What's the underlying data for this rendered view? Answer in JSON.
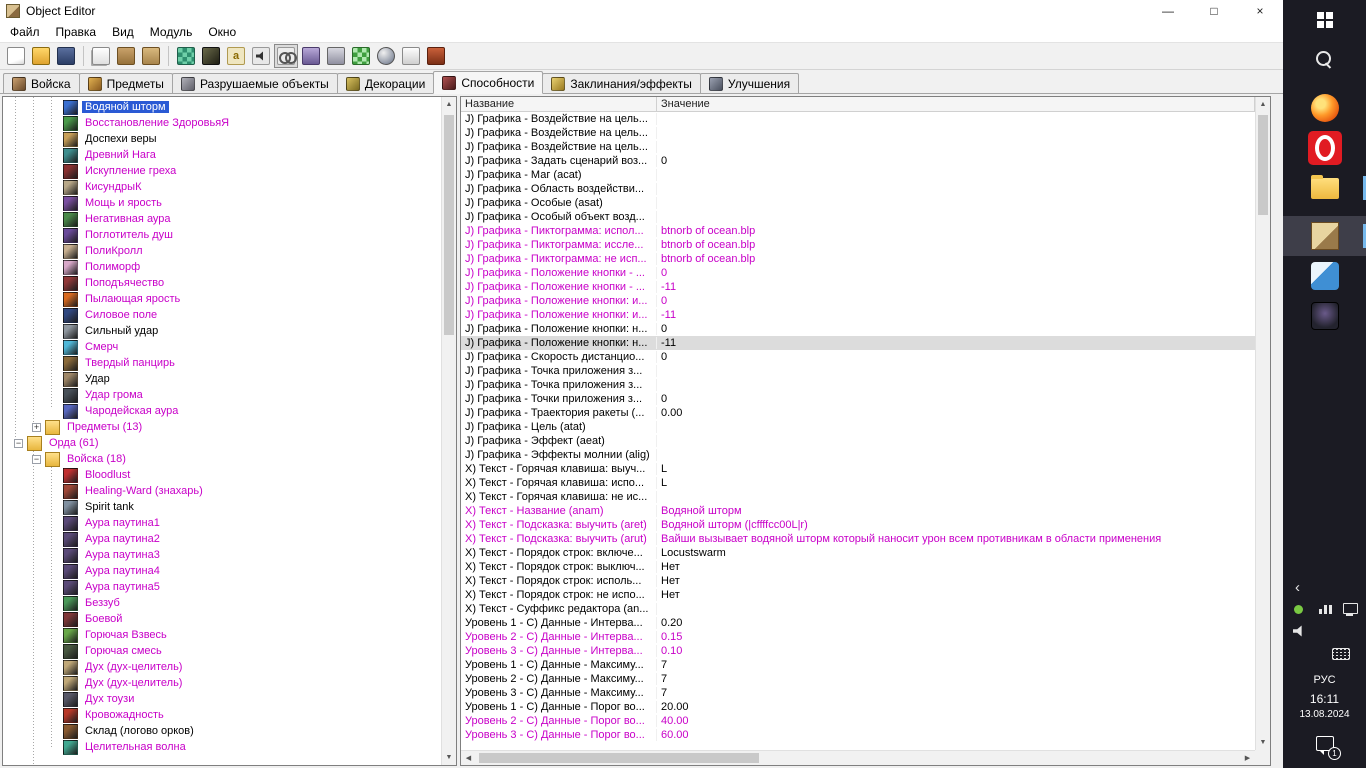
{
  "window": {
    "title": "Object Editor",
    "min": "—",
    "max": "□",
    "close": "×"
  },
  "colors": {
    "selection": "#2a5ad4",
    "modified": "#c800c8",
    "taskbar": "#1b1b23",
    "opera_red": "#e11b22"
  },
  "menu": {
    "items": [
      "Файл",
      "Правка",
      "Вид",
      "Модуль",
      "Окно"
    ]
  },
  "toolbar": {
    "buttons": [
      {
        "name": "new-map",
        "icon": "new"
      },
      {
        "name": "open-map",
        "icon": "open"
      },
      {
        "name": "save-map",
        "icon": "save"
      },
      {
        "sep": true
      },
      {
        "name": "copy",
        "icon": "copy"
      },
      {
        "name": "paste",
        "icon": "paste"
      },
      {
        "name": "clipboard",
        "icon": "clip2"
      },
      {
        "sep": true
      },
      {
        "name": "terrain-editor",
        "icon": "terrain"
      },
      {
        "name": "trigger-editor",
        "icon": "trig"
      },
      {
        "name": "sound-editor",
        "icon": "snda"
      },
      {
        "name": "speaker",
        "icon": "spk"
      },
      {
        "name": "object-editor",
        "icon": "obj",
        "active": true
      },
      {
        "name": "campaign-editor",
        "icon": "camp"
      },
      {
        "name": "ai-editor",
        "icon": "ai"
      },
      {
        "name": "object-manager",
        "icon": "mgr"
      },
      {
        "name": "import-manager",
        "icon": "imp"
      },
      {
        "name": "export",
        "icon": "exp"
      },
      {
        "name": "test-map",
        "icon": "test"
      }
    ]
  },
  "tabs": {
    "items": [
      {
        "id": "units",
        "label": "Войска"
      },
      {
        "id": "items",
        "label": "Предметы"
      },
      {
        "id": "destructibles",
        "label": "Разрушаемые объекты"
      },
      {
        "id": "doodads",
        "label": "Декорации"
      },
      {
        "id": "abilities",
        "label": "Способности",
        "active": true
      },
      {
        "id": "buffs",
        "label": "Заклинания/эффекты"
      },
      {
        "id": "upgrades",
        "label": "Улучшения"
      }
    ]
  },
  "tree": {
    "items": [
      {
        "label": "Водяной шторм",
        "d": 3,
        "t": "leaf",
        "sel": true,
        "c": "#3a6fd0"
      },
      {
        "label": "Восстановление ЗдоровьяЯ",
        "d": 3,
        "t": "leaf",
        "m": true,
        "c": "#4a9a4a"
      },
      {
        "label": "Доспехи веры",
        "d": 3,
        "t": "leaf",
        "c": "#c8a058"
      },
      {
        "label": "Древний Нага",
        "d": 3,
        "t": "leaf",
        "m": true,
        "c": "#3e8e8e"
      },
      {
        "label": "Искупление греха",
        "d": 3,
        "t": "leaf",
        "m": true,
        "c": "#8a3030"
      },
      {
        "label": "КисундрыК",
        "d": 3,
        "t": "leaf",
        "m": true,
        "c": "#b8a888"
      },
      {
        "label": "Мощь и ярость",
        "d": 3,
        "t": "leaf",
        "m": true,
        "c": "#7a4fa0"
      },
      {
        "label": "Негативная аура",
        "d": 3,
        "t": "leaf",
        "m": true,
        "c": "#4a8a4a"
      },
      {
        "label": "Поглотитель душ",
        "d": 3,
        "t": "leaf",
        "m": true,
        "c": "#6a4a9a"
      },
      {
        "label": "ПолиКролл",
        "d": 3,
        "t": "leaf",
        "m": true,
        "c": "#c8b090"
      },
      {
        "label": "Полиморф",
        "d": 3,
        "t": "leaf",
        "m": true,
        "c": "#d8a8c8"
      },
      {
        "label": "Поподъячество",
        "d": 3,
        "t": "leaf",
        "m": true,
        "c": "#903838"
      },
      {
        "label": "Пылающая ярость",
        "d": 3,
        "t": "leaf",
        "m": true,
        "c": "#d86a20"
      },
      {
        "label": "Силовое поле",
        "d": 3,
        "t": "leaf",
        "m": true,
        "c": "#304880"
      },
      {
        "label": "Сильный удар",
        "d": 3,
        "t": "leaf",
        "c": "#9098a0"
      },
      {
        "label": "Смерч",
        "d": 3,
        "t": "leaf",
        "m": true,
        "c": "#50b8d8"
      },
      {
        "label": "Твердый панцирь",
        "d": 3,
        "t": "leaf",
        "m": true,
        "c": "#8a6a3a"
      },
      {
        "label": "Удар",
        "d": 3,
        "t": "leaf",
        "c": "#a08868"
      },
      {
        "label": "Удар грома",
        "d": 3,
        "t": "leaf",
        "m": true,
        "c": "#485058"
      },
      {
        "label": "Чародейская аура",
        "d": 3,
        "t": "leaf",
        "m": true,
        "c": "#5868c0"
      },
      {
        "label": "Предметы (13)",
        "d": 2,
        "t": "folder",
        "x": "+",
        "m": true
      },
      {
        "label": "Орда (61)",
        "d": 1,
        "t": "folder",
        "x": "-",
        "m": true
      },
      {
        "label": "Войска (18)",
        "d": 2,
        "t": "folder",
        "x": "-",
        "m": true
      },
      {
        "label": "Bloodlust",
        "d": 3,
        "t": "leaf",
        "m": true,
        "c": "#c03030"
      },
      {
        "label": "Healing-Ward (знахарь)",
        "d": 3,
        "t": "leaf",
        "m": true,
        "c": "#a04838"
      },
      {
        "label": "Spirit tank",
        "d": 3,
        "t": "leaf",
        "c": "#8090a0"
      },
      {
        "label": "Аура паутина1",
        "d": 3,
        "t": "leaf",
        "m": true,
        "c": "#5a4a78"
      },
      {
        "label": "Аура паутина2",
        "d": 3,
        "t": "leaf",
        "m": true,
        "c": "#5a4a78"
      },
      {
        "label": "Аура паутина3",
        "d": 3,
        "t": "leaf",
        "m": true,
        "c": "#5a4a78"
      },
      {
        "label": "Аура паутина4",
        "d": 3,
        "t": "leaf",
        "m": true,
        "c": "#5a4a78"
      },
      {
        "label": "Аура паутина5",
        "d": 3,
        "t": "leaf",
        "m": true,
        "c": "#5a4a78"
      },
      {
        "label": "Беззуб",
        "d": 3,
        "t": "leaf",
        "m": true,
        "c": "#4a9858"
      },
      {
        "label": "Боевой",
        "d": 3,
        "t": "leaf",
        "m": true,
        "c": "#803838"
      },
      {
        "label": "Горючая Взвесь",
        "d": 3,
        "t": "leaf",
        "m": true,
        "c": "#68a848"
      },
      {
        "label": "Горючая смесь",
        "d": 3,
        "t": "leaf",
        "m": true,
        "c": "#485840"
      },
      {
        "label": "Дух (дух-целитель)",
        "d": 3,
        "t": "leaf",
        "m": true,
        "c": "#c0a878"
      },
      {
        "label": "Дух (дух-целитель)",
        "d": 3,
        "t": "leaf",
        "m": true,
        "c": "#c0a878"
      },
      {
        "label": "Дух тоузи",
        "d": 3,
        "t": "leaf",
        "m": true,
        "c": "#585868"
      },
      {
        "label": "Кровожадность",
        "d": 3,
        "t": "leaf",
        "m": true,
        "c": "#b83828"
      },
      {
        "label": "Склад (логово орков)",
        "d": 3,
        "t": "leaf",
        "c": "#8a5a30"
      },
      {
        "label": "Целительная волна",
        "d": 3,
        "t": "leaf",
        "m": true,
        "c": "#40a890"
      }
    ]
  },
  "properties": {
    "columns": [
      "Название",
      "Значение"
    ],
    "rows": [
      {
        "n": "J) Графика - Воздействие на цель...",
        "v": ""
      },
      {
        "n": "J) Графика - Воздействие на цель...",
        "v": ""
      },
      {
        "n": "J) Графика - Воздействие на цель...",
        "v": ""
      },
      {
        "n": "J) Графика - Задать сценарий воз...",
        "v": "0"
      },
      {
        "n": "J) Графика - Маг (acat)",
        "v": ""
      },
      {
        "n": "J) Графика - Область воздействи...",
        "v": ""
      },
      {
        "n": "J) Графика - Особые (asat)",
        "v": ""
      },
      {
        "n": "J) Графика - Особый объект возд...",
        "v": ""
      },
      {
        "n": "J) Графика - Пиктограмма: испол...",
        "v": "btnorb of ocean.blp",
        "m": true
      },
      {
        "n": "J) Графика - Пиктограмма: иссле...",
        "v": "btnorb of ocean.blp",
        "m": true
      },
      {
        "n": "J) Графика - Пиктограмма: не исп...",
        "v": "btnorb of ocean.blp",
        "m": true
      },
      {
        "n": "J) Графика - Положение кнопки - ...",
        "v": "0",
        "m": true
      },
      {
        "n": "J) Графика - Положение кнопки - ...",
        "v": "-11",
        "m": true
      },
      {
        "n": "J) Графика - Положение кнопки: и...",
        "v": "0",
        "m": true
      },
      {
        "n": "J) Графика - Положение кнопки: и...",
        "v": "-11",
        "m": true
      },
      {
        "n": "J) Графика - Положение кнопки: н...",
        "v": "0"
      },
      {
        "n": "J) Графика - Положение кнопки: н...",
        "v": "-11",
        "s": true
      },
      {
        "n": "J) Графика - Скорость дистанцио...",
        "v": "0"
      },
      {
        "n": "J) Графика - Точка приложения з...",
        "v": ""
      },
      {
        "n": "J) Графика - Точка приложения з...",
        "v": ""
      },
      {
        "n": "J) Графика - Точки приложения з...",
        "v": "0"
      },
      {
        "n": "J) Графика - Траектория ракеты (...",
        "v": "0.00"
      },
      {
        "n": "J) Графика - Цель (atat)",
        "v": ""
      },
      {
        "n": "J) Графика - Эффект (aeat)",
        "v": ""
      },
      {
        "n": "J) Графика - Эффекты молнии (alig)",
        "v": ""
      },
      {
        "n": "X) Текст - Горячая клавиша: выуч...",
        "v": "L"
      },
      {
        "n": "X) Текст - Горячая клавиша: испо...",
        "v": "L"
      },
      {
        "n": "X) Текст - Горячая клавиша: не ис...",
        "v": ""
      },
      {
        "n": "X) Текст - Название (anam)",
        "v": "Водяной шторм",
        "m": true
      },
      {
        "n": "X) Текст - Подсказка: выучить (aret)",
        "v": "Водяной шторм (|cffffcc00L|r)",
        "m": true
      },
      {
        "n": "X) Текст - Подсказка: выучить (arut)",
        "v": "Вайши вызывает водяной шторм который наносит урон всем противникам в области применения",
        "m": true
      },
      {
        "n": "X) Текст - Порядок строк: включе...",
        "v": "Locustswarm"
      },
      {
        "n": "X) Текст - Порядок строк: выключ...",
        "v": "Нет"
      },
      {
        "n": "X) Текст - Порядок строк: исполь...",
        "v": "Нет"
      },
      {
        "n": "X) Текст - Порядок строк: не испо...",
        "v": "Нет"
      },
      {
        "n": "X) Текст - Суффикс редактора (an...",
        "v": ""
      },
      {
        "n": "Уровень 1 - С) Данные - Интерва...",
        "v": "0.20"
      },
      {
        "n": "Уровень 2 - С) Данные - Интерва...",
        "v": "0.15",
        "m": true
      },
      {
        "n": "Уровень 3 - С) Данные - Интерва...",
        "v": "0.10",
        "m": true
      },
      {
        "n": "Уровень 1 - С) Данные - Максиму...",
        "v": "7"
      },
      {
        "n": "Уровень 2 - С) Данные - Максиму...",
        "v": "7"
      },
      {
        "n": "Уровень 3 - С) Данные - Максиму...",
        "v": "7"
      },
      {
        "n": "Уровень 1 - С) Данные - Порог во...",
        "v": "20.00"
      },
      {
        "n": "Уровень 2 - С) Данные - Порог во...",
        "v": "40.00",
        "m": true
      },
      {
        "n": "Уровень 3 - С) Данные - Порог во...",
        "v": "60.00",
        "m": true
      }
    ]
  },
  "taskbar": {
    "apps": [
      {
        "id": "start"
      },
      {
        "id": "search"
      },
      {
        "id": "firefox",
        "gap": true
      },
      {
        "id": "opera"
      },
      {
        "id": "explorer",
        "open": true
      },
      {
        "id": "weapp",
        "focused": true,
        "gap": true
      },
      {
        "id": "blueapp"
      },
      {
        "id": "darkapp"
      }
    ],
    "tray": {
      "lang": "РУС",
      "time": "16:11",
      "date": "13.08.2024",
      "badge": "1"
    }
  }
}
